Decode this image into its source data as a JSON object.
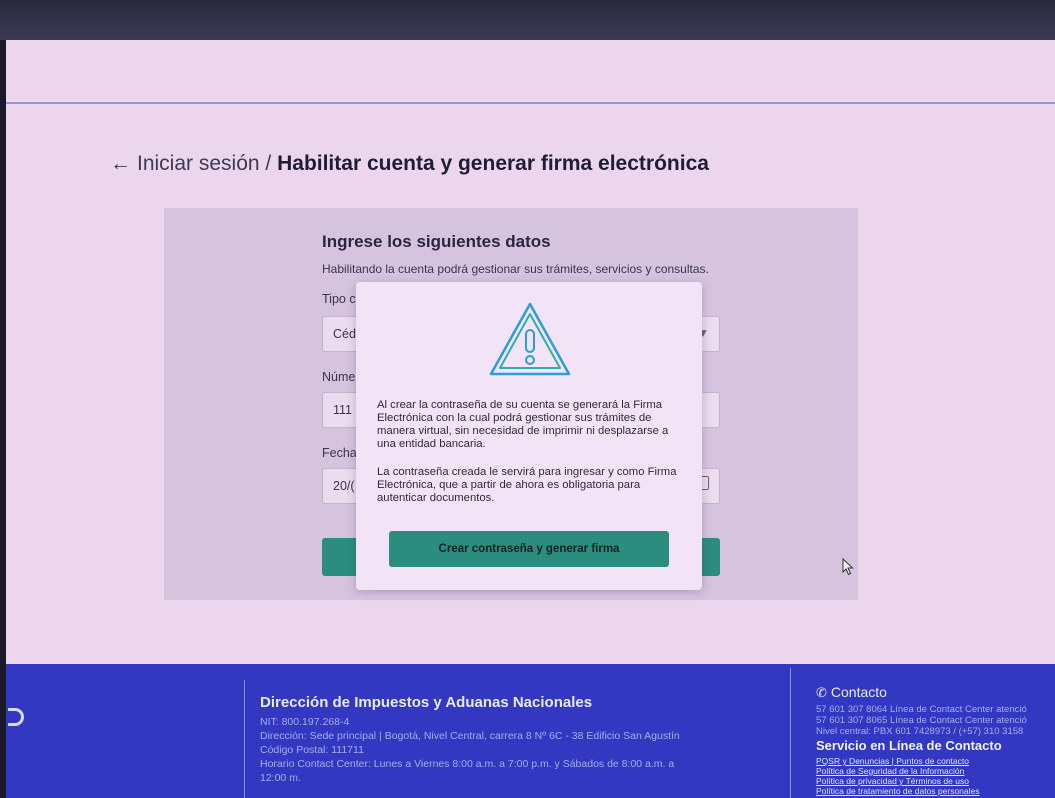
{
  "breadcrumb": {
    "arrow": "←",
    "back": "Iniciar sesión",
    "separator": "/",
    "current": "Habilitar cuenta y generar firma electrónica"
  },
  "form": {
    "title": "Ingrese los siguientes datos",
    "subtitle": "Habilitando la cuenta podrá gestionar sus trámites, servicios y consultas.",
    "label_tipo": "Tipo c",
    "value_tipo": "Céd",
    "label_numero": "Núme",
    "value_numero": "111",
    "label_fecha": "Fecha",
    "value_fecha": "20/("
  },
  "modal": {
    "icon": "warning-triangle-icon",
    "paragraph1": "Al crear la contraseña de su cuenta se generará la Firma Electrónica con la cual podrá gestionar sus trámites de manera virtual, sin necesidad de imprimir ni desplazarse a una entidad bancaria.",
    "paragraph2": "La contraseña creada le servirá para ingresar y como Firma Electrónica, que a partir de ahora es obligatoria para autenticar documentos.",
    "button": "Crear contraseña y generar firma"
  },
  "footer": {
    "org": "Dirección de Impuestos y Aduanas Nacionales",
    "nit": "NIT: 800.197.268-4",
    "address": "Dirección: Sede principal | Bogotá, Nivel Central, carrera 8 Nº 6C - 38 Edificio San Agustín",
    "postal": "Código Postal: 111711",
    "hours": "Horario Contact Center: Lunes a Viernes 8:00 a.m. a 7:00 p.m. y Sábados de 8:00 a.m. a",
    "hours2": "12:00 m.",
    "contact_title": "Contacto",
    "contact_line1": "57 601 307 8064 Línea de Contact Center atenció",
    "contact_line2": "57 601 307 8065 Línea de Contact Center atenció",
    "contact_line3": "Nivel central: PBX 601 7428973 / (+57) 310 3158",
    "service_title": "Servicio en Línea de Contacto",
    "link_pqsr": "PQSR y Denuncias",
    "link_sep": "|",
    "link_puntos": "Puntos de contacto",
    "link_seguridad": "Política de Seguridad de la Información",
    "link_privacidad": "Política de privacidad y Términos de uso",
    "link_datos": "Política de tratamiento de datos personales"
  },
  "colors": {
    "primary": "#2b8d7f",
    "footer": "#3238c2",
    "warning_stroke": "#2a9fd4"
  }
}
